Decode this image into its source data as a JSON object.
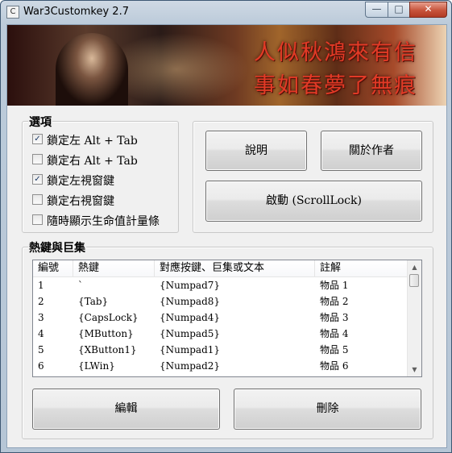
{
  "window": {
    "title": "War3Customkey 2.7",
    "app_icon_glyph": "C",
    "minimize_glyph": "—",
    "maximize_glyph": "□",
    "close_glyph": "✕"
  },
  "banner": {
    "line1": "人似秋鴻來有信",
    "line2": "事如春夢了無痕"
  },
  "options": {
    "legend": "選項",
    "items": [
      {
        "label": "鎖定左 Alt + Tab",
        "checked": true
      },
      {
        "label": "鎖定右 Alt + Tab",
        "checked": false
      },
      {
        "label": "鎖定左視窗鍵",
        "checked": true
      },
      {
        "label": "鎖定右視窗鍵",
        "checked": false
      },
      {
        "label": "隨時顯示生命值計量條",
        "checked": false
      }
    ]
  },
  "buttons": {
    "about": "說明",
    "author": "關於作者",
    "start": "啟動 (ScrollLock)",
    "edit": "編輯",
    "delete": "刪除"
  },
  "hotkeys": {
    "legend": "熱鍵與巨集",
    "columns": [
      "編號",
      "熱鍵",
      "對應按鍵、巨集或文本",
      "註解"
    ],
    "rows": [
      [
        "1",
        "`",
        "{Numpad7}",
        "物品 1"
      ],
      [
        "2",
        "{Tab}",
        "{Numpad8}",
        "物品 2"
      ],
      [
        "3",
        "{CapsLock}",
        "{Numpad4}",
        "物品 3"
      ],
      [
        "4",
        "{MButton}",
        "{Numpad5}",
        "物品 4"
      ],
      [
        "5",
        "{XButton1}",
        "{Numpad1}",
        "物品 5"
      ],
      [
        "6",
        "{LWin}",
        "{Numpad2}",
        "物品 6"
      ]
    ]
  }
}
